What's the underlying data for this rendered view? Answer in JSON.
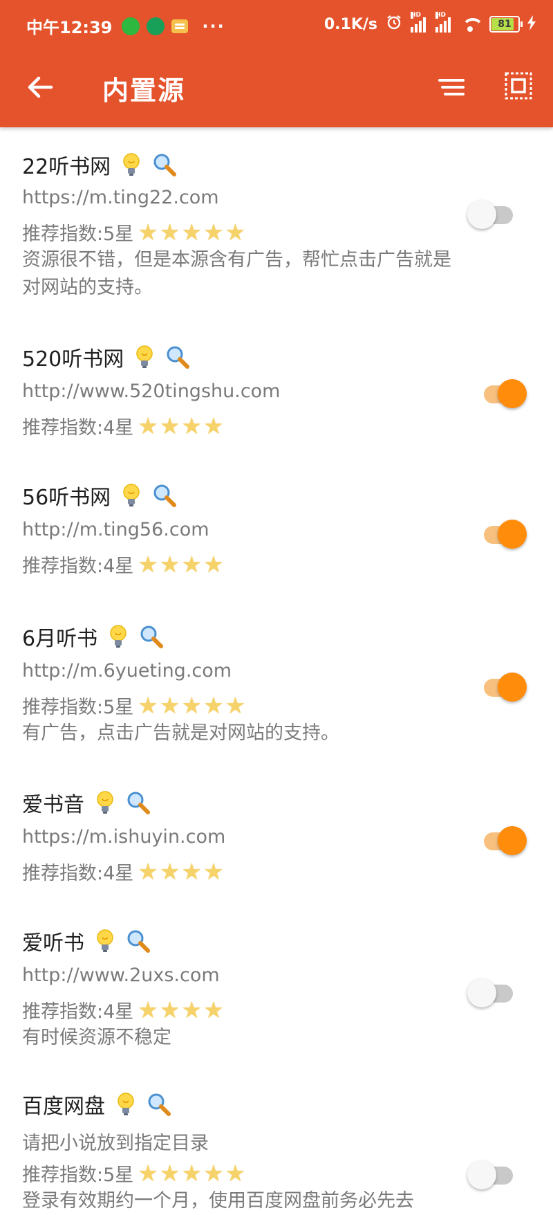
{
  "status_bar": {
    "time": "中午12:39",
    "more": "···",
    "net_speed": "0.1K/s",
    "hd1": "HD",
    "hd2": "HD",
    "battery": "81",
    "icons": [
      "wechat-icon",
      "ca-app-icon",
      "message-icon",
      "alarm-icon",
      "signal-icon",
      "wifi-icon",
      "battery-icon",
      "charging-icon"
    ]
  },
  "app_bar": {
    "title": "内置源",
    "background": "#e5532c"
  },
  "accent_color": "#ff8c0a",
  "sources": [
    {
      "name": "22听书网",
      "url": "https://m.ting22.com",
      "note": "",
      "rating_label": "推荐指数:5星",
      "stars": 5,
      "description": "资源很不错，但是本源含有广告，帮忙点击广告就是对网站的支持。",
      "enabled": false
    },
    {
      "name": "520听书网",
      "url": "http://www.520tingshu.com",
      "note": "",
      "rating_label": "推荐指数:4星",
      "stars": 4,
      "description": "",
      "enabled": true
    },
    {
      "name": "56听书网",
      "url": "http://m.ting56.com",
      "note": "",
      "rating_label": "推荐指数:4星",
      "stars": 4,
      "description": "",
      "enabled": true
    },
    {
      "name": "6月听书",
      "url": "http://m.6yueting.com",
      "note": "",
      "rating_label": "推荐指数:5星",
      "stars": 5,
      "description": "有广告，点击广告就是对网站的支持。",
      "enabled": true
    },
    {
      "name": "爱书音",
      "url": "https://m.ishuyin.com",
      "note": "",
      "rating_label": "推荐指数:4星",
      "stars": 4,
      "description": "",
      "enabled": true
    },
    {
      "name": "爱听书",
      "url": "http://www.2uxs.com",
      "note": "",
      "rating_label": "推荐指数:4星",
      "stars": 4,
      "description": "有时候资源不稳定",
      "enabled": false
    },
    {
      "name": "百度网盘",
      "url": "",
      "note": "请把小说放到指定目录",
      "rating_label": "推荐指数:5星",
      "stars": 5,
      "description": "登录有效期约一个月，使用百度网盘前务必先去",
      "enabled": false
    }
  ]
}
